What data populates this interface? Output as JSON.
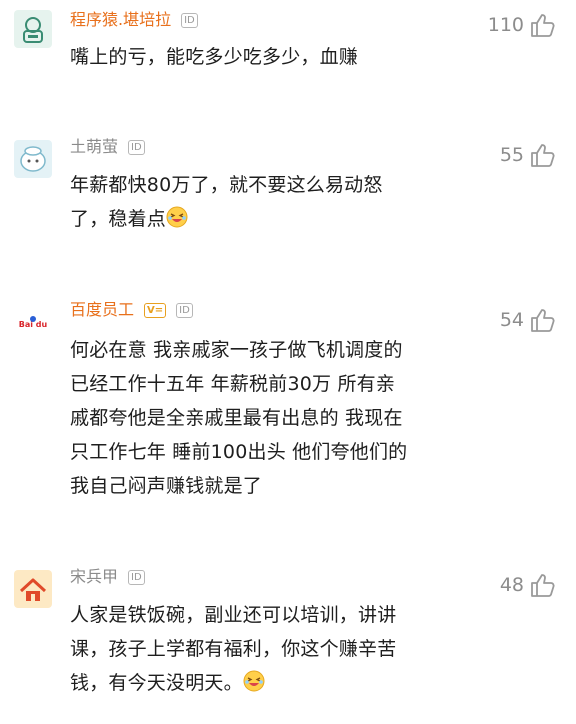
{
  "comments": [
    {
      "username": "程序猿.堪培拉",
      "id_label": "ID",
      "lines": [
        "嘴上的亏，能吃多少吃多少，血赚"
      ],
      "likes": "110"
    },
    {
      "username": "土萌萤",
      "id_label": "ID",
      "lines": [
        "年薪都快80万了，就不要这么易动怒",
        "了，稳着点"
      ],
      "likes": "55"
    },
    {
      "username": "百度员工",
      "v_label": "V=",
      "id_label": "ID",
      "avatar_text": "Bai du",
      "lines": [
        "何必在意 我亲戚家一孩子做飞机调度的",
        "已经工作十五年 年薪税前30万 所有亲",
        "戚都夸他是全亲戚里最有出息的 我现在",
        "只工作七年 睡前100出头 他们夸他们的",
        "我自己闷声赚钱就是了"
      ],
      "likes": "54"
    },
    {
      "username": "宋兵甲",
      "id_label": "ID",
      "lines": [
        "人家是铁饭碗，副业还可以培训，讲讲",
        "课，孩子上学都有福利，你这个赚辛苦",
        "钱，有今天没明天。"
      ],
      "likes": "48"
    }
  ],
  "colors": {
    "username_highlight": "#e8701c",
    "username_normal": "#8b8b8b",
    "like_icon": "#9a9a9a"
  }
}
